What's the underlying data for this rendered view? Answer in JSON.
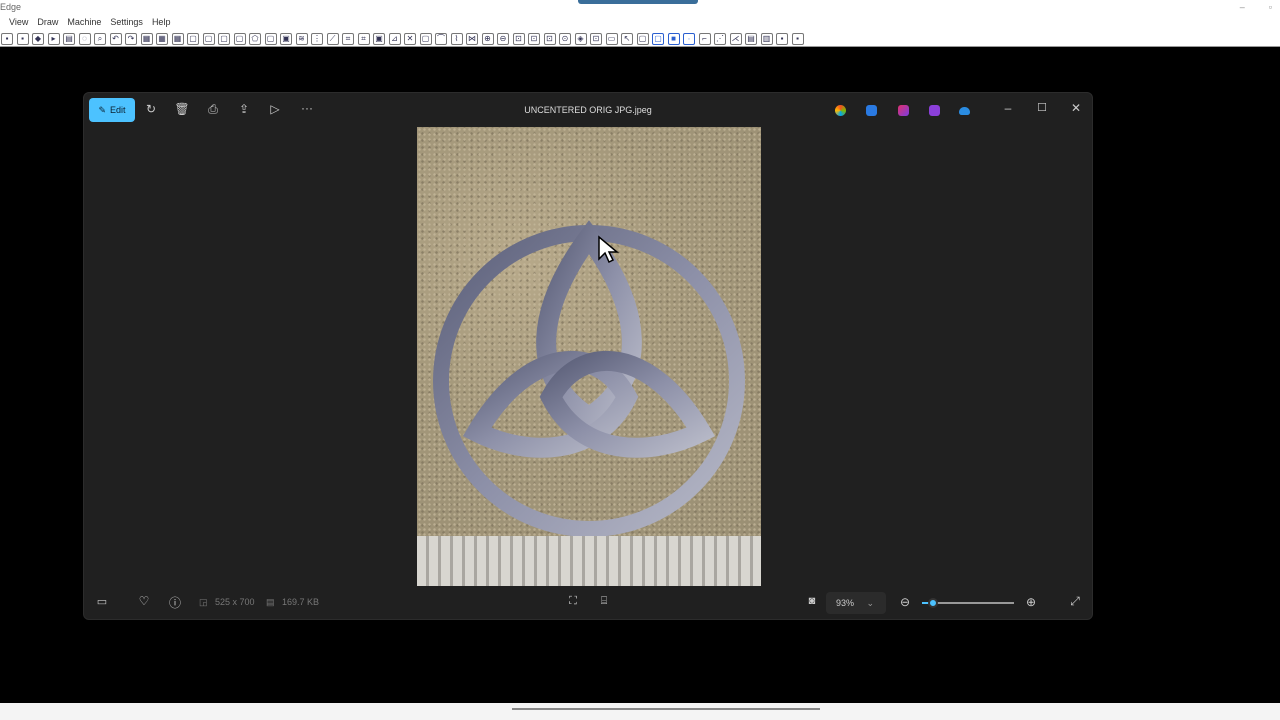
{
  "host_app": {
    "title": "Edge",
    "menu": [
      "View",
      "Draw",
      "Machine",
      "Settings",
      "Help"
    ],
    "toolbar_icon_count": 52
  },
  "photos": {
    "file_title": "UNCENTERED ORIG JPG.jpeg",
    "edit_label": "Edit",
    "more_label": "···",
    "dimensions": "525 x 700",
    "file_size": "169.7 KB",
    "zoom_level": "93%",
    "zoom_fraction": 0.12,
    "accent": "#4cc2ff"
  }
}
